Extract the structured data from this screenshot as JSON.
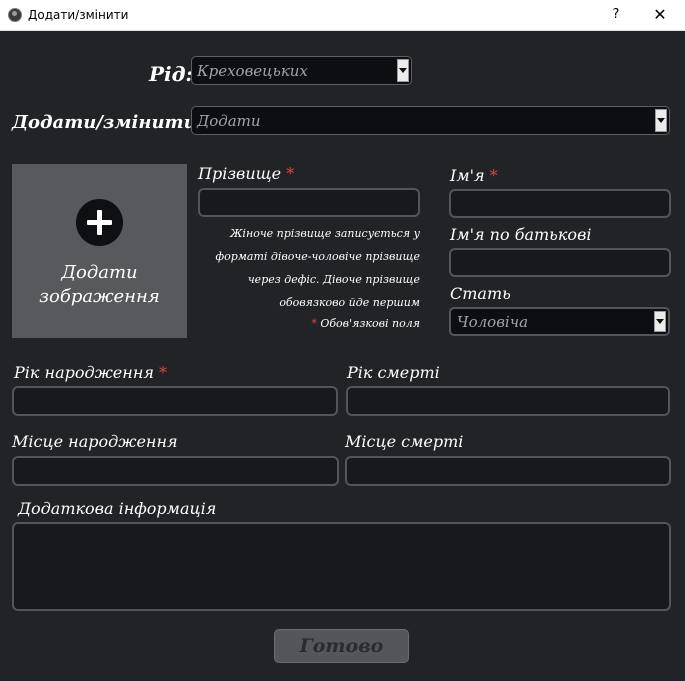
{
  "window": {
    "title": "Додати/змінити",
    "help": "?",
    "close": "✕"
  },
  "clan": {
    "label": "Рід:",
    "value": "Креховецьких"
  },
  "mode": {
    "label": "Додати/змінити:",
    "value": "Додати"
  },
  "image": {
    "label": "Додати зображення"
  },
  "surname": {
    "label": "Прізвище",
    "note": "Жіноче прізвище записується у форматі дівоче-чоловіче прізвище через дефіс. Дівоче прізвище обовязково йде першим"
  },
  "first_name": {
    "label": "Ім'я"
  },
  "patronymic": {
    "label": "Ім'я по батькові"
  },
  "gender": {
    "label": "Стать",
    "value": "Чоловіча"
  },
  "required_mark": "*",
  "required_note": "Обов'язкові поля",
  "birth_year": {
    "label": "Рік народження"
  },
  "death_year": {
    "label": "Рік смерті"
  },
  "birth_place": {
    "label": "Місце народження"
  },
  "death_place": {
    "label": "Місце смерті"
  },
  "additional_info": {
    "label": "Додаткова інформація"
  },
  "done_button": "Готово",
  "colors": {
    "background": "#222327",
    "required": "#e0433b",
    "field_border": "#52555c",
    "button_face": "#54565b"
  }
}
